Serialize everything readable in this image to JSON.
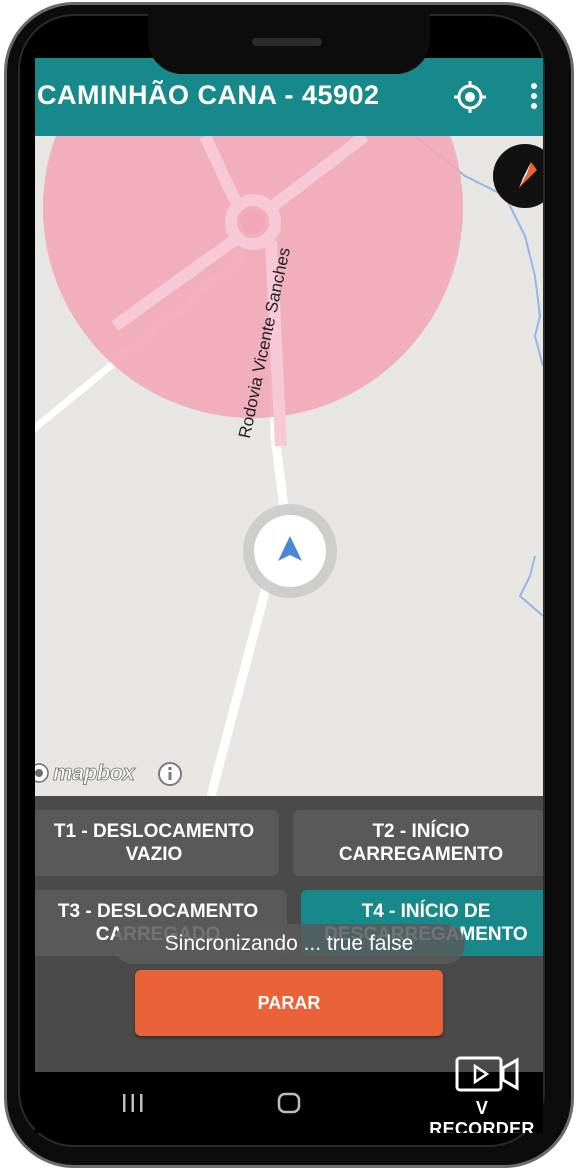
{
  "appbar": {
    "title": "CAMINHÃO CANA - 45902",
    "locate_icon": "my-location-icon",
    "menu_icon": "more-vert-icon"
  },
  "map": {
    "road_label": "Rodovia Vicente Sanches",
    "attribution_logo": "mapbox",
    "info_icon": "info-icon",
    "compass_icon": "compass-icon",
    "marker_icon": "navigation-arrow-icon",
    "geofence_color": "#f2a7b8",
    "marker_color": "#4b86d8"
  },
  "tasks": [
    {
      "label": "T1  -  DESLOCAMENTO VAZIO"
    },
    {
      "label": "T2  -  INÍCIO CARREGAMENTO"
    },
    {
      "label": "T3  -  DESLOCAMENTO CARREGADO"
    },
    {
      "label": "T4  -  INÍCIO DE DESCARREGAMENTO"
    }
  ],
  "toast": {
    "text": "Sincronizando ... true false"
  },
  "stop_button": {
    "label": "PARAR",
    "color": "#ea6338"
  },
  "accent_color": "#17898a",
  "recorder": {
    "label": "V RECORDER",
    "icon": "video-recorder-icon"
  },
  "navbar": {
    "recent_icon": "recent-apps-icon",
    "home_icon": "home-icon"
  }
}
